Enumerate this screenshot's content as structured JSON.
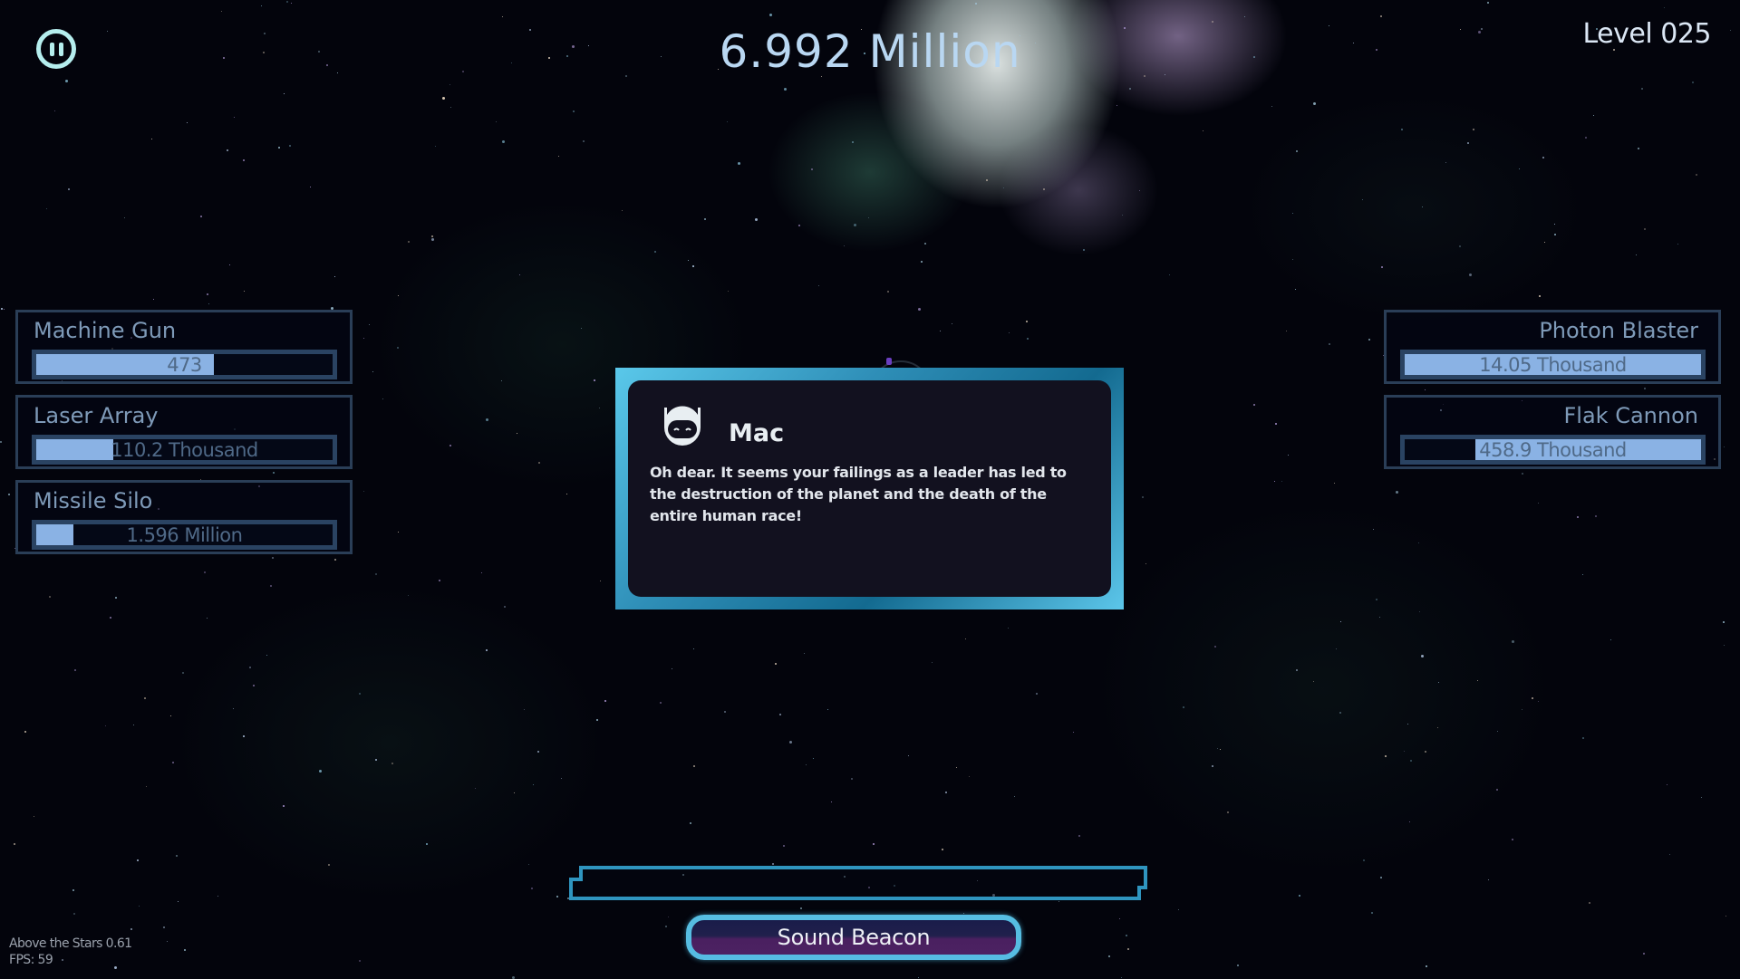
{
  "hud": {
    "score": "6.992 Million",
    "level": "Level 025",
    "pause_icon": "pause-icon"
  },
  "weapons_left": [
    {
      "name": "Machine Gun",
      "value": "473",
      "fill": 0.6,
      "direction": "ltr"
    },
    {
      "name": "Laser Array",
      "value": "110.2 Thousand",
      "fill": 0.26,
      "direction": "ltr"
    },
    {
      "name": "Missile Silo",
      "value": "1.596 Million",
      "fill": 0.125,
      "direction": "ltr"
    }
  ],
  "weapons_right": [
    {
      "name": "Photon Blaster",
      "value": "14.05 Thousand",
      "fill": 1.0,
      "direction": "rtl"
    },
    {
      "name": "Flak Cannon",
      "value": "458.9 Thousand",
      "fill": 0.76,
      "direction": "rtl"
    }
  ],
  "dialog": {
    "speaker": "Mac",
    "avatar_icon": "robot-icon",
    "message": "Oh dear. It seems your failings as a leader has led to the destruction of the planet and the death of the entire human race!"
  },
  "action": {
    "progress": 0,
    "button_label": "Sound Beacon"
  },
  "footer": {
    "version": "Above the Stars 0.61",
    "fps": "FPS: 59"
  },
  "colors": {
    "accent": "#56bde2",
    "bar_fill": "#8ab2e4",
    "panel_border": "#2a3e57"
  }
}
